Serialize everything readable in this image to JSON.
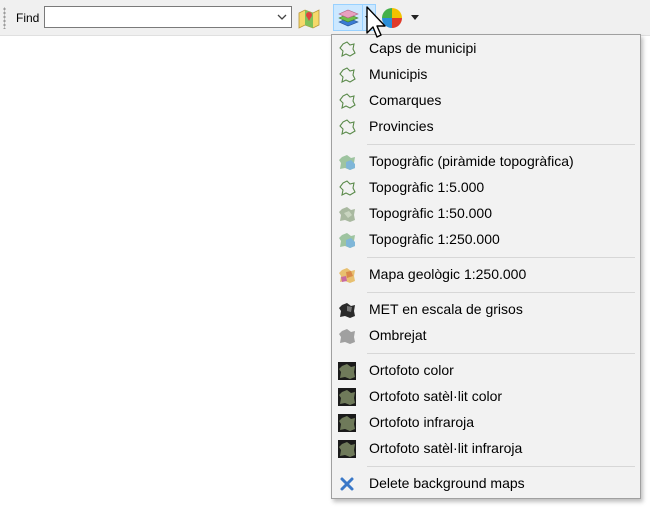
{
  "toolbar": {
    "find_label": "Find",
    "find_value": "",
    "icons": [
      "map-search-icon",
      "layers-icon",
      "dropdown-arrow-icon",
      "color-palette-icon",
      "dropdown-arrow-icon"
    ]
  },
  "menu": {
    "groups": [
      [
        {
          "label": "Caps de municipi",
          "icon": "outline-map-icon"
        },
        {
          "label": "Municipis",
          "icon": "outline-map-icon"
        },
        {
          "label": "Comarques",
          "icon": "outline-map-icon"
        },
        {
          "label": "Provincies",
          "icon": "outline-map-icon"
        }
      ],
      [
        {
          "label": "Topogràfic (piràmide topogràfica)",
          "icon": "topographic-pyramid-icon"
        },
        {
          "label": "Topogràfic 1:5.000",
          "icon": "outline-map-icon"
        },
        {
          "label": "Topogràfic 1:50.000",
          "icon": "topographic-map-icon"
        },
        {
          "label": "Topogràfic 1:250.000",
          "icon": "topographic-pyramid-icon"
        }
      ],
      [
        {
          "label": "Mapa geològic 1:250.000",
          "icon": "geologic-map-icon"
        }
      ],
      [
        {
          "label": "MET en escala de grisos",
          "icon": "elevation-map-icon"
        },
        {
          "label": "Ombrejat",
          "icon": "hillshade-map-icon"
        }
      ],
      [
        {
          "label": "Ortofoto color",
          "icon": "orthophoto-icon"
        },
        {
          "label": "Ortofoto satèl·lit color",
          "icon": "orthophoto-icon"
        },
        {
          "label": "Ortofoto infraroja",
          "icon": "orthophoto-icon"
        },
        {
          "label": "Ortofoto satèl·lit infraroja",
          "icon": "orthophoto-icon"
        }
      ],
      [
        {
          "label": "Delete background maps",
          "icon": "delete-x-icon"
        }
      ]
    ]
  }
}
